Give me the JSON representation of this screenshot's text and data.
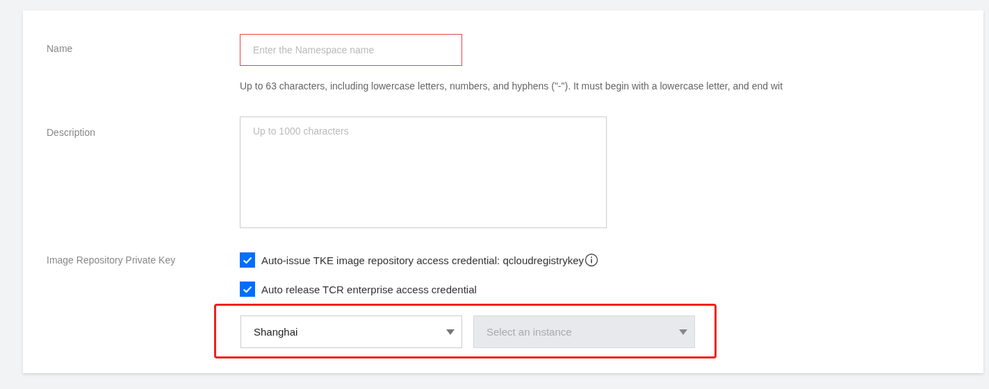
{
  "form": {
    "name": {
      "label": "Name",
      "placeholder": "Enter the Namespace name",
      "invalid": true,
      "hint": "Up to 63 characters, including lowercase letters, numbers, and hyphens (\"-\"). It must begin with a lowercase letter, and end wit"
    },
    "description": {
      "label": "Description",
      "placeholder": "Up to 1000 characters"
    },
    "private_key": {
      "label": "Image Repository Private Key",
      "options": [
        {
          "label": "Auto-issue TKE image repository access credential: qcloudregistrykey",
          "checked": true,
          "info": true
        },
        {
          "label": "Auto release TCR enterprise access credential",
          "checked": true,
          "info": false
        }
      ],
      "highlighted": true,
      "selects": [
        {
          "value": "Shanghai",
          "disabled": false
        },
        {
          "placeholder": "Select an instance",
          "disabled": true
        }
      ]
    }
  }
}
